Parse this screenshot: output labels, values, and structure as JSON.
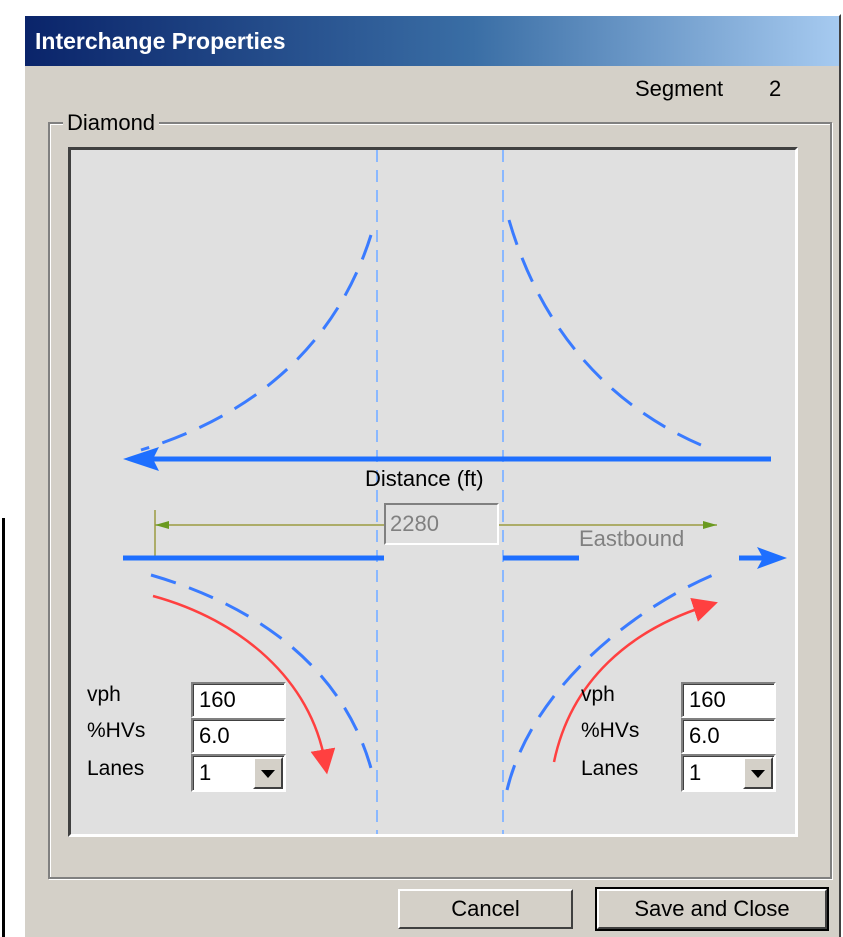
{
  "window": {
    "title": "Interchange Properties"
  },
  "segment": {
    "label": "Segment",
    "value": "2"
  },
  "group": {
    "label": "Diamond"
  },
  "diagram": {
    "distance_label": "Distance (ft)",
    "distance_value": "2280",
    "direction_label": "Eastbound",
    "colors": {
      "freeway": "#1e6fff",
      "ramp": "#3a7bff",
      "movement": "#ff4040",
      "crossroad": "#8ab8ff",
      "dimension": "#9a9a40"
    }
  },
  "left_ramp": {
    "vph_label": "vph",
    "vph_value": "160",
    "hv_label": "%HVs",
    "hv_value": "6.0",
    "lanes_label": "Lanes",
    "lanes_value": "1"
  },
  "right_ramp": {
    "vph_label": "vph",
    "vph_value": "160",
    "hv_label": "%HVs",
    "hv_value": "6.0",
    "lanes_label": "Lanes",
    "lanes_value": "1"
  },
  "buttons": {
    "cancel": "Cancel",
    "save_close": "Save and Close"
  }
}
